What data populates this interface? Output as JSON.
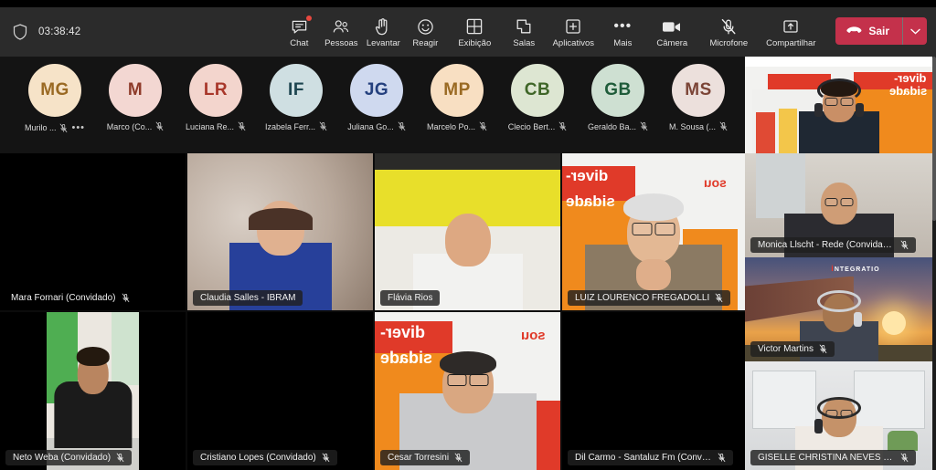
{
  "meeting": {
    "timer": "03:38:42",
    "shield_icon": "shield-icon"
  },
  "toolbar": {
    "items": [
      {
        "label": "Chat",
        "icon": "chat-icon",
        "badge": true
      },
      {
        "label": "Pessoas",
        "icon": "people-icon",
        "badge": false
      },
      {
        "label": "Levantar",
        "icon": "raise-hand-icon",
        "badge": false
      },
      {
        "label": "Reagir",
        "icon": "emoji-icon",
        "badge": false
      },
      {
        "label": "Exibição",
        "icon": "grid-view-icon",
        "badge": false
      },
      {
        "label": "Salas",
        "icon": "breakout-rooms-icon",
        "badge": false
      },
      {
        "label": "Aplicativos",
        "icon": "apps-plus-icon",
        "badge": false
      },
      {
        "label": "Mais",
        "icon": "more-ellipsis-icon",
        "badge": false
      }
    ],
    "right_items": [
      {
        "label": "Câmera",
        "icon": "camera-icon"
      },
      {
        "label": "Microfone",
        "icon": "microphone-muted-icon"
      },
      {
        "label": "Compartilhar",
        "icon": "share-screen-icon"
      }
    ],
    "leave": {
      "label": "Sair",
      "icon": "hangup-icon",
      "caret_icon": "chevron-down-icon",
      "color": "#c4314b"
    }
  },
  "participant_avatars": [
    {
      "initials": "MG",
      "name": "Murilo ...",
      "bg": "#f6e3c8",
      "fg": "#9a6a23",
      "muted": true,
      "overflow": true
    },
    {
      "initials": "M",
      "name": "Marco (Co...",
      "bg": "#f3d7d2",
      "fg": "#8e3b2a",
      "muted": true,
      "overflow": false
    },
    {
      "initials": "LR",
      "name": "Luciana Re...",
      "bg": "#f3d5cd",
      "fg": "#a8372a",
      "muted": true,
      "overflow": false
    },
    {
      "initials": "IF",
      "name": "Izabela Ferr...",
      "bg": "#cfdfe2",
      "fg": "#1d4550",
      "muted": true,
      "overflow": false
    },
    {
      "initials": "JG",
      "name": "Juliana Go...",
      "bg": "#cfd9ef",
      "fg": "#24407e",
      "muted": true,
      "overflow": false
    },
    {
      "initials": "MP",
      "name": "Marcelo Po...",
      "bg": "#f8dfc2",
      "fg": "#9a6a23",
      "muted": true,
      "overflow": false
    },
    {
      "initials": "CB",
      "name": "Clecio Bert...",
      "bg": "#dde6d2",
      "fg": "#3f6628",
      "muted": true,
      "overflow": false
    },
    {
      "initials": "GB",
      "name": "Geraldo Ba...",
      "bg": "#cee0d2",
      "fg": "#1f5c3a",
      "muted": true,
      "overflow": false
    },
    {
      "initials": "MS",
      "name": "M. Sousa (...",
      "bg": "#ece0dc",
      "fg": "#7b4436",
      "muted": true,
      "overflow": false
    }
  ],
  "video_tiles": [
    {
      "name": "Mara Fornari (Convidado)",
      "muted": true,
      "scene": "black",
      "label_style": "plain"
    },
    {
      "name": "Claudia Salles - IBRAM",
      "muted": false,
      "scene": "blur-warm",
      "label_style": "chip"
    },
    {
      "name": "Flávia Rios",
      "muted": false,
      "scene": "yellow-shelf",
      "label_style": "chip"
    },
    {
      "name": "LUIZ LOURENCO FREGADOLLI",
      "muted": true,
      "scene": "diversidade-senior",
      "label_style": "chip"
    },
    {
      "name": "Neto Weba (Convidado)",
      "muted": true,
      "scene": "portrait-office-green",
      "label_style": "chip"
    },
    {
      "name": "Cristiano Lopes (Convidado)",
      "muted": true,
      "scene": "black",
      "label_style": "chip"
    },
    {
      "name": "Cesar Torresini",
      "muted": true,
      "scene": "diversidade-man",
      "label_style": "chip"
    },
    {
      "name": "Dil Carmo - Santaluz Fm (Convida...",
      "muted": true,
      "scene": "black",
      "label_style": "chip"
    }
  ],
  "rail_tiles": [
    {
      "name": "",
      "muted": false,
      "scene": "diversidade-host",
      "has_label": false
    },
    {
      "name": "Monica Llscht - Rede (Convidado)",
      "muted": true,
      "scene": "indoor-window",
      "has_label": true
    },
    {
      "name": "Victor Martins",
      "muted": true,
      "scene": "bridge-sunset",
      "has_label": true
    },
    {
      "name": "GISELLE CHRISTINA NEVES DE OLI...",
      "muted": true,
      "scene": "office-interior",
      "has_label": true
    }
  ],
  "branding": {
    "word_top": "diver-",
    "word_bottom": "sidade",
    "mark": "sou"
  }
}
